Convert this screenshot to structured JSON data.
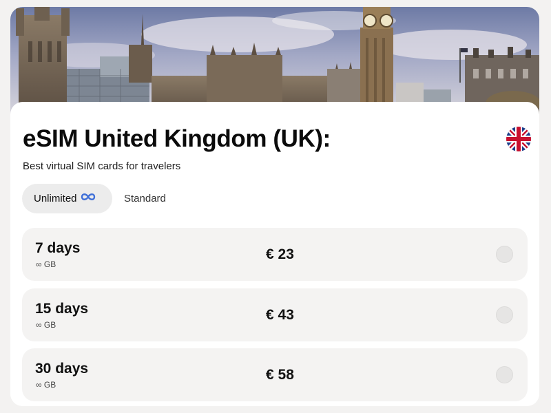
{
  "page": {
    "title": "eSIM United Kingdom (UK):",
    "subtitle": "Best virtual SIM cards for travelers",
    "flag_icon": "uk-flag-icon",
    "hero_image": "london-westminster-skyline"
  },
  "tabs": [
    {
      "label": "Unlimited",
      "icon": "infinity-icon",
      "active": true
    },
    {
      "label": "Standard",
      "active": false
    }
  ],
  "plans": [
    {
      "duration": "7 days",
      "data": "∞ GB",
      "price": "€ 23",
      "selected": false
    },
    {
      "duration": "15 days",
      "data": "∞ GB",
      "price": "€ 43",
      "selected": false
    },
    {
      "duration": "30 days",
      "data": "∞ GB",
      "price": "€ 58",
      "selected": false
    }
  ],
  "colors": {
    "background": "#f3f2f1",
    "card": "#ffffff",
    "plan_row": "#f4f3f2",
    "active_tab": "#ececec",
    "infinity_accent": "#3f6fd8",
    "flag_blue": "#1f3f8a",
    "flag_red": "#c8102e"
  }
}
